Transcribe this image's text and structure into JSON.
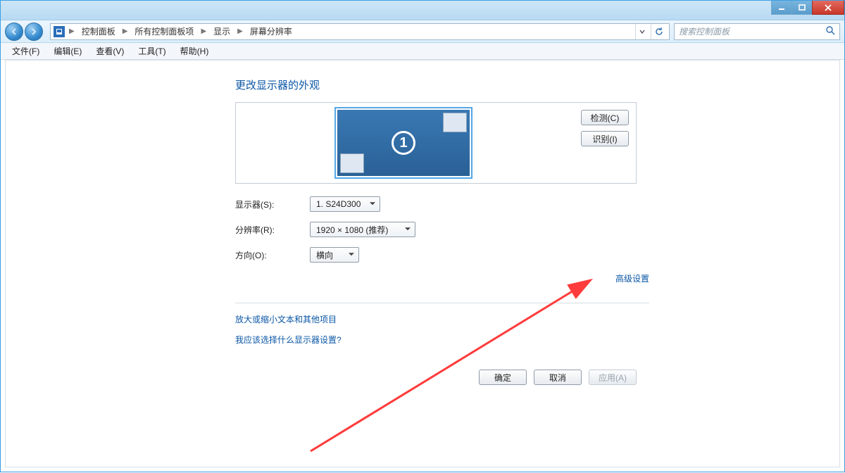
{
  "breadcrumb": {
    "seg1": "控制面板",
    "seg2": "所有控制面板项",
    "seg3": "显示",
    "seg4": "屏幕分辨率"
  },
  "search": {
    "placeholder": "搜索控制面板"
  },
  "menu": {
    "file": "文件(F)",
    "edit": "编辑(E)",
    "view": "查看(V)",
    "tools": "工具(T)",
    "help": "帮助(H)"
  },
  "page": {
    "title": "更改显示器的外观"
  },
  "monitor": {
    "number": "1"
  },
  "buttons": {
    "detect": "检测(C)",
    "identify": "识别(I)",
    "ok": "确定",
    "cancel": "取消",
    "apply": "应用(A)"
  },
  "labels": {
    "display": "显示器(S):",
    "resolution": "分辨率(R):",
    "orientation": "方向(O):"
  },
  "values": {
    "display": "1. S24D300",
    "resolution": "1920 × 1080 (推荐)",
    "orientation": "横向"
  },
  "links": {
    "advanced": "高级设置",
    "textsize": "放大或缩小文本和其他项目",
    "whichdisplay": "我应该选择什么显示器设置?"
  }
}
